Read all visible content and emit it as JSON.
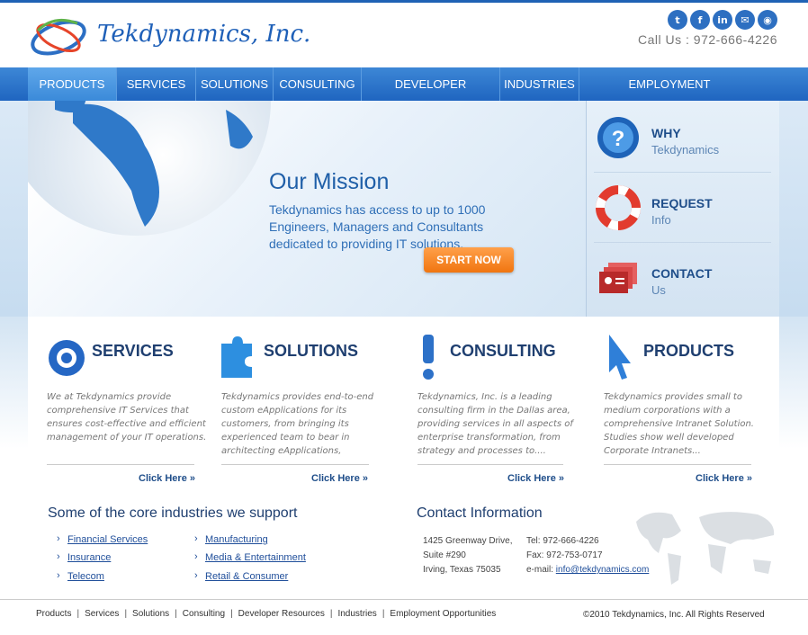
{
  "header": {
    "brand": "Tekdynamics, Inc.",
    "call_label": "Call Us :",
    "phone": "972-666-4226",
    "social": [
      "twitter-icon",
      "facebook-icon",
      "linkedin-icon",
      "email-icon",
      "rss-icon"
    ]
  },
  "nav": {
    "items": [
      "PRODUCTS",
      "SERVICES",
      "SOLUTIONS",
      "CONSULTING",
      "DEVELOPER RESOURCES",
      "INDUSTRIES",
      "EMPLOYMENT OPPORTUNITIES"
    ]
  },
  "hero": {
    "title": "Our Mission",
    "text": "Tekdynamics has access to up to 1000 Engineers, Managers and Consultants dedicated to providing IT solutions.",
    "button": "START NOW"
  },
  "side": [
    {
      "title": "WHY",
      "sub": "Tekdynamics"
    },
    {
      "title": "REQUEST",
      "sub": "Info"
    },
    {
      "title": "CONTACT",
      "sub": "Us"
    }
  ],
  "columns": [
    {
      "title": "SERVICES",
      "text": "We at Tekdynamics provide comprehensive IT Services that ensures cost-effective and efficient management of your IT operations.",
      "link": "Click Here"
    },
    {
      "title": "SOLUTIONS",
      "text": "Tekdynamics provides end-to-end custom eApplications for its customers, from bringing its experienced team to bear in architecting eApplications,",
      "link": "Click Here"
    },
    {
      "title": "CONSULTING",
      "text": "Tekdynamics, Inc. is a leading consulting firm in the Dallas area, providing services in all aspects of enterprise transformation, from strategy and processes to....",
      "link": "Click Here"
    },
    {
      "title": "PRODUCTS",
      "text": "Tekdynamics provides small to medium corporations with a comprehensive Intranet Solution. Studies show well developed Corporate Intranets...",
      "link": "Click Here"
    }
  ],
  "industries": {
    "title": "Some of the core industries we support",
    "left": [
      "Financial Services",
      "Insurance",
      "Telecom"
    ],
    "right": [
      "Manufacturing",
      "Media & Entertainment",
      "Retail & Consumer"
    ]
  },
  "contact": {
    "title": "Contact Information",
    "address1": "1425 Greenway Drive,",
    "address2": "Suite #290",
    "address3": "Irving, Texas 75035",
    "tel": "Tel: 972-666-4226",
    "fax": "Fax: 972-753-0717",
    "email_label": "e-mail:",
    "email": "info@tekdynamics.com"
  },
  "footer": {
    "links": [
      "Products",
      "Services",
      "Solutions",
      "Consulting",
      "Developer Resources",
      "Industries",
      "Employment Opportunities"
    ],
    "copyright": "©2010 Tekdynamics, Inc. All Rights Reserved"
  }
}
